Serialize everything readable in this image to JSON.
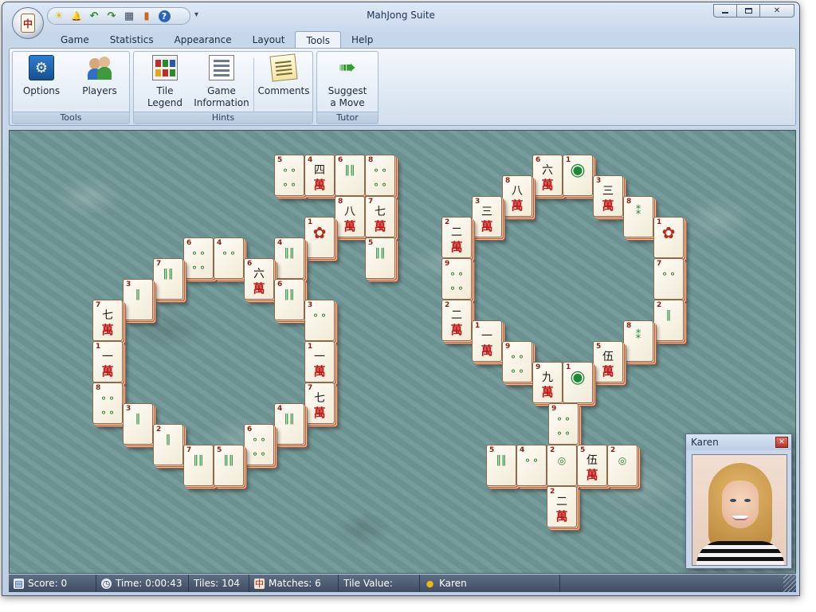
{
  "window": {
    "title": "MahJong Suite"
  },
  "quick_access": {
    "buttons": [
      {
        "icon": "sun-icon",
        "glyph": "☀"
      },
      {
        "icon": "bell-icon",
        "glyph": "🔔"
      },
      {
        "icon": "undo-icon",
        "glyph": "↶"
      },
      {
        "icon": "redo-icon",
        "glyph": "↷"
      },
      {
        "icon": "grid-icon",
        "glyph": "▦"
      },
      {
        "icon": "chart-icon",
        "glyph": "▮"
      },
      {
        "icon": "help-icon",
        "glyph": "?"
      }
    ],
    "more_glyph": "▾"
  },
  "tabs": [
    "Game",
    "Statistics",
    "Appearance",
    "Layout",
    "Tools",
    "Help"
  ],
  "active_tab": "Tools",
  "ribbon": {
    "groups": [
      {
        "label": "Tools",
        "buttons": [
          {
            "label": "Options"
          },
          {
            "label": "Players"
          }
        ]
      },
      {
        "label": "Hints",
        "buttons": [
          {
            "label": "Tile\nLegend"
          },
          {
            "label": "Game\nInformation"
          },
          {
            "label": "Comments"
          }
        ]
      },
      {
        "label": "Tutor",
        "buttons": [
          {
            "label": "Suggest\na Move"
          }
        ]
      }
    ]
  },
  "opponent": {
    "name": "Karen",
    "close_glyph": "✕"
  },
  "status": {
    "score": "Score: 0",
    "time": "Time: 0:00:43",
    "tiles": "Tiles: 104",
    "matches": "Matches: 6",
    "tile_value": "Tile Value:",
    "player": "Karen"
  },
  "colors": {
    "felt": "#6f9796",
    "tile_edge": "#c84a2e",
    "statusbar": "#4b5a70"
  }
}
